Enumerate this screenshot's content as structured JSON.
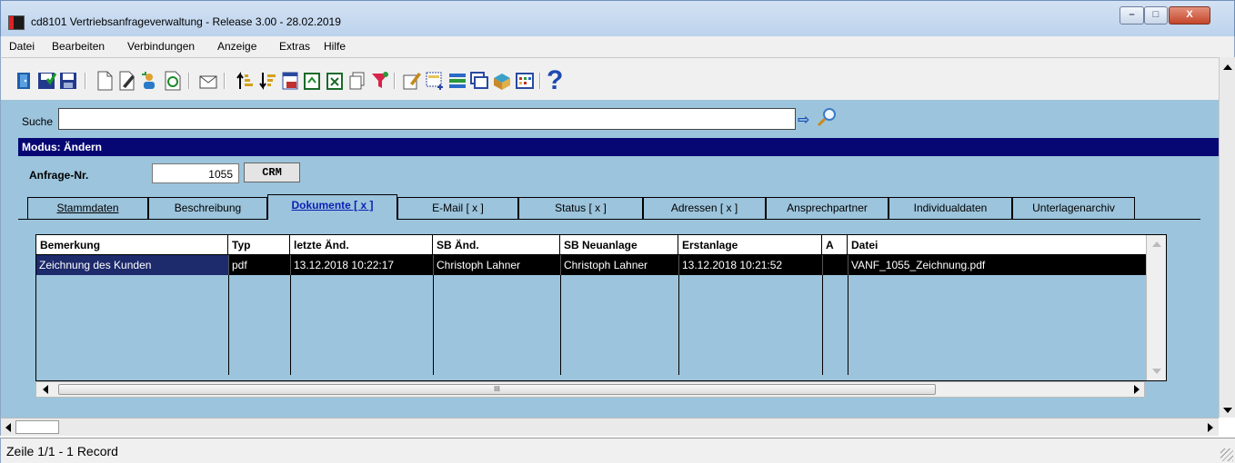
{
  "window": {
    "title": "cd8101 Vertriebsanfrageverwaltung - Release 3.00 - 28.02.2019",
    "minimize_glyph": "–",
    "maximize_glyph": "□",
    "close_glyph": "X"
  },
  "menu": {
    "items": [
      "Datei",
      "Bearbeiten",
      "Verbindungen",
      "Anzeige",
      "Extras",
      "Hilfe"
    ]
  },
  "toolbar": {
    "icons": [
      "exit-door-icon",
      "save-check-icon",
      "save-icon",
      "new-document-icon",
      "edit-pen-icon",
      "copy-person-icon",
      "refresh-icon",
      "mail-icon",
      "sort-ascending-icon",
      "sort-descending-icon",
      "calendar-number-icon",
      "export-icon",
      "excel-icon",
      "copy-pages-icon",
      "filter-funnel-icon",
      "edit-note-icon",
      "add-record-icon",
      "transfer-icon",
      "windows-icon",
      "folder-book-icon",
      "grid-table-icon",
      "help-icon"
    ],
    "help_glyph": "?"
  },
  "search": {
    "label": "Suche",
    "value": "",
    "go_glyph": "⇨"
  },
  "mode": {
    "text": "Modus: Ändern"
  },
  "anfrage": {
    "label": "Anfrage-Nr.",
    "value": "1055",
    "crm_label": "CRM"
  },
  "tabs": [
    {
      "label": "Stammdaten",
      "active": false
    },
    {
      "label": "Beschreibung",
      "active": false
    },
    {
      "label": "Dokumente [ x ]",
      "active": true
    },
    {
      "label": "E-Mail [ x ]",
      "active": false
    },
    {
      "label": "Status [ x ]",
      "active": false
    },
    {
      "label": "Adressen [ x ]",
      "active": false
    },
    {
      "label": "Ansprechpartner",
      "active": false
    },
    {
      "label": "Individualdaten",
      "active": false
    },
    {
      "label": "Unterlagenarchiv",
      "active": false
    }
  ],
  "grid": {
    "columns": [
      "Bemerkung",
      "Typ",
      "letzte Änd.",
      "SB Änd.",
      "SB Neuanlage",
      "Erstanlage",
      "A",
      "Datei"
    ],
    "rows": [
      [
        "Zeichnung des Kunden",
        "pdf",
        "13.12.2018 10:22:17",
        "Christoph Lahner",
        "Christoph Lahner",
        "13.12.2018 10:21:52",
        "",
        "VANF_1055_Zeichnung.pdf"
      ]
    ],
    "hscroll_glyph": "III"
  },
  "status": {
    "text": "Zeile 1/1 - 1 Record"
  },
  "colors": {
    "client_bg": "#9cc4dc",
    "mode_bar": "#070774",
    "active_tab_text": "#0b1fb5",
    "selected_row": "#000000"
  }
}
